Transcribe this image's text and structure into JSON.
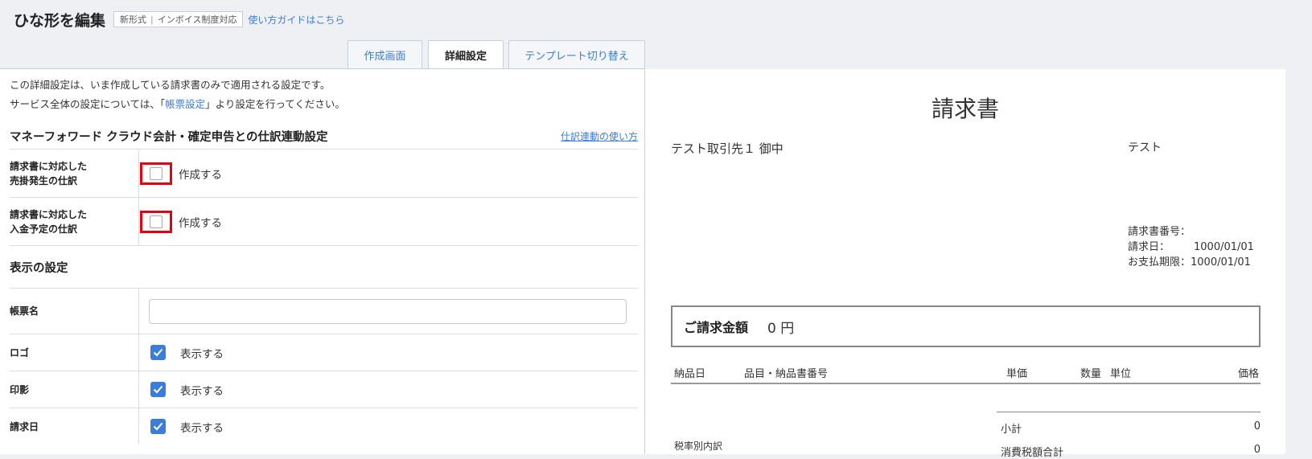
{
  "header": {
    "title": "ひな形を編集",
    "badge_left": "新形式",
    "badge_right": "インボイス制度対応",
    "guide_link": "使い方ガイドはこちら"
  },
  "tabs": [
    {
      "label": "作成画面"
    },
    {
      "label": "詳細設定"
    },
    {
      "label": "テンプレート切り替え"
    }
  ],
  "intro": {
    "line1": "この詳細設定は、いま作成している請求書のみで適用される設定です。",
    "line2_prefix": "サービス全体の設定については、「",
    "line2_link": "帳票設定",
    "line2_suffix": "」より設定を行ってください。"
  },
  "journal_section": {
    "title": "マネーフォワード クラウド会計・確定申告との仕訳連動設定",
    "help_link": "仕訳連動の使い方",
    "rows": [
      {
        "label_line1": "請求書に対応した",
        "label_line2": "売掛発生の仕訳",
        "option": "作成する",
        "checked": false
      },
      {
        "label_line1": "請求書に対応した",
        "label_line2": "入金予定の仕訳",
        "option": "作成する",
        "checked": false
      }
    ]
  },
  "display_section": {
    "title": "表示の設定",
    "doc_name_label": "帳票名",
    "doc_name_value": "",
    "rows": [
      {
        "label": "ロゴ",
        "option": "表示する",
        "checked": true
      },
      {
        "label": "印影",
        "option": "表示する",
        "checked": true
      },
      {
        "label": "請求日",
        "option": "表示する",
        "checked": true
      }
    ]
  },
  "preview": {
    "title": "請求書",
    "client": "テスト取引先１ 御中",
    "sender": "テスト",
    "invoice_no_label": "請求書番号：",
    "invoice_no_value": "",
    "date_label": "請求日：",
    "date_value": "1000/01/01",
    "due_label": "お支払期限：",
    "due_value": "1000/01/01",
    "amount_label": "ご請求金額",
    "amount_value": "0 円",
    "columns": [
      "納品日",
      "品目・納品書番号",
      "単価",
      "数量",
      "単位",
      "価格"
    ],
    "subtotal_label": "小計",
    "subtotal_value": "0",
    "tax_total_label": "消費税額合計",
    "tax_total_value": "0",
    "tax_breakdown_label": "税率別内訳"
  },
  "colors": {
    "accent": "#3b7dd8",
    "highlight": "#e60012"
  }
}
